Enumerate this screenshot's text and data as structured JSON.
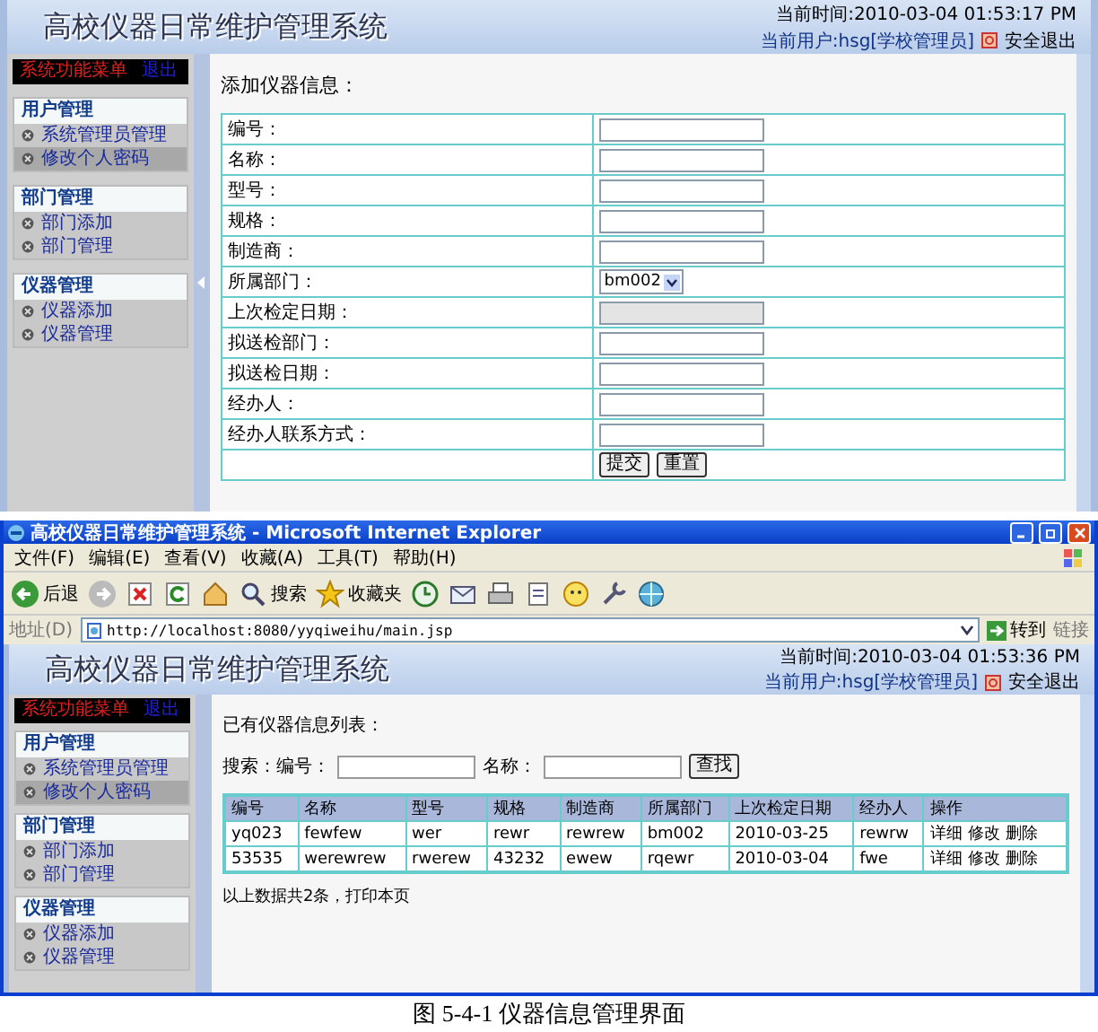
{
  "top_screen": {
    "header": {
      "title": "高校仪器日常维护管理系统",
      "time": "当前时间:2010-03-04 01:53:17 PM",
      "user": "当前用户:hsg[学校管理员]",
      "logout": "安全退出"
    },
    "sidebar": {
      "menu_title": "系统功能菜单",
      "menu_action": "退出",
      "groups": [
        {
          "title": "用户管理",
          "items": [
            {
              "label": "系统管理员管理",
              "selected": false
            },
            {
              "label": "修改个人密码",
              "selected": true
            }
          ]
        },
        {
          "title": "部门管理",
          "items": [
            {
              "label": "部门添加",
              "selected": false
            },
            {
              "label": "部门管理",
              "selected": false
            }
          ]
        },
        {
          "title": "仪器管理",
          "items": [
            {
              "label": "仪器添加",
              "selected": false
            },
            {
              "label": "仪器管理",
              "selected": false
            }
          ]
        }
      ]
    },
    "form": {
      "title": "添加仪器信息：",
      "fields": [
        {
          "label": "编号：",
          "kind": "text",
          "disabled": false
        },
        {
          "label": "名称：",
          "kind": "text",
          "disabled": false
        },
        {
          "label": "型号：",
          "kind": "text",
          "disabled": false
        },
        {
          "label": "规格：",
          "kind": "text",
          "disabled": false
        },
        {
          "label": "制造商：",
          "kind": "text",
          "disabled": false
        },
        {
          "label": "所属部门：",
          "kind": "select",
          "value": "bm002"
        },
        {
          "label": "上次检定日期：",
          "kind": "text",
          "disabled": true
        },
        {
          "label": "拟送检部门：",
          "kind": "text",
          "disabled": false
        },
        {
          "label": "拟送检日期：",
          "kind": "text",
          "disabled": false
        },
        {
          "label": "经办人：",
          "kind": "text",
          "disabled": false
        },
        {
          "label": "经办人联系方式：",
          "kind": "text",
          "disabled": false
        }
      ],
      "buttons": [
        "提交",
        "重置"
      ]
    }
  },
  "browser": {
    "title": "高校仪器日常维护管理系统 - Microsoft Internet Explorer",
    "menu": [
      "文件(F)",
      "编辑(E)",
      "查看(V)",
      "收藏(A)",
      "工具(T)",
      "帮助(H)"
    ],
    "toolbar": [
      {
        "kind": "back",
        "label": "后退"
      },
      {
        "kind": "forward"
      },
      {
        "kind": "stop"
      },
      {
        "kind": "refresh"
      },
      {
        "kind": "home"
      },
      {
        "kind": "search",
        "label": "搜索"
      },
      {
        "kind": "favorites",
        "label": "收藏夹"
      },
      {
        "kind": "history"
      },
      {
        "kind": "mail"
      },
      {
        "kind": "print"
      },
      {
        "kind": "edit"
      },
      {
        "kind": "chat"
      },
      {
        "kind": "tool"
      },
      {
        "kind": "network"
      }
    ],
    "address_label": "地址(D)",
    "url": "http://localhost:8080/yyqiweihu/main.jsp",
    "go": "转到",
    "links": "链接",
    "app": {
      "header": {
        "title": "高校仪器日常维护管理系统",
        "time": "当前时间:2010-03-04 01:53:36 PM",
        "user": "当前用户:hsg[学校管理员]",
        "logout": "安全退出"
      },
      "sidebar": {
        "menu_title": "系统功能菜单",
        "menu_action": "退出",
        "groups": [
          {
            "title": "用户管理",
            "items": [
              {
                "label": "系统管理员管理",
                "selected": false
              },
              {
                "label": "修改个人密码",
                "selected": true
              }
            ]
          },
          {
            "title": "部门管理",
            "items": [
              {
                "label": "部门添加",
                "selected": false
              },
              {
                "label": "部门管理",
                "selected": false
              }
            ]
          },
          {
            "title": "仪器管理",
            "items": [
              {
                "label": "仪器添加",
                "selected": false
              },
              {
                "label": "仪器管理",
                "selected": false
              }
            ]
          }
        ]
      },
      "list": {
        "title": "已有仪器信息列表：",
        "search_label": "搜索：编号：",
        "name_label": "名称：",
        "search_button": "查找",
        "columns": [
          "编号",
          "名称",
          "型号",
          "规格",
          "制造商",
          "所属部门",
          "上次检定日期",
          "经办人",
          "操作"
        ],
        "rows": [
          {
            "cells": [
              "yq023",
              "fewfew",
              "wer",
              "rewr",
              "rewrew",
              "bm002",
              "2010-03-25",
              "rewrw"
            ],
            "actions": [
              "详细",
              "修改",
              "删除"
            ]
          },
          {
            "cells": [
              "53535",
              "werewrew",
              "rwerew",
              "43232",
              "ewew",
              "rqewr",
              "2010-03-04",
              "fwe"
            ],
            "actions": [
              "详细",
              "修改",
              "删除"
            ]
          }
        ],
        "footer_text": "以上数据共2条，",
        "footer_link": "打印本页"
      }
    }
  },
  "caption": "图 5-4-1 仪器信息管理界面"
}
